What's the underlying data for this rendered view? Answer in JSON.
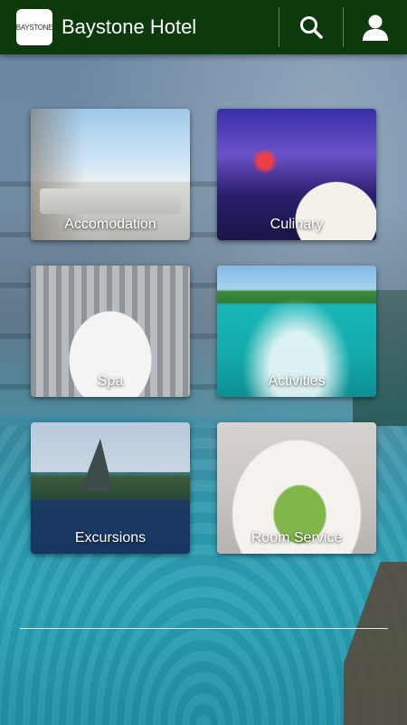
{
  "app": {
    "title": "Baystone Hotel",
    "logo_text": "BAYSTONE"
  },
  "topbar": {
    "search_icon": "search-icon",
    "user_icon": "user-icon",
    "background_color": "#0c3a0c"
  },
  "tiles": [
    {
      "label": "Accomodation"
    },
    {
      "label": "Culinary"
    },
    {
      "label": "Spa"
    },
    {
      "label": "Activities"
    },
    {
      "label": "Excursions"
    },
    {
      "label": "Room Service"
    }
  ]
}
